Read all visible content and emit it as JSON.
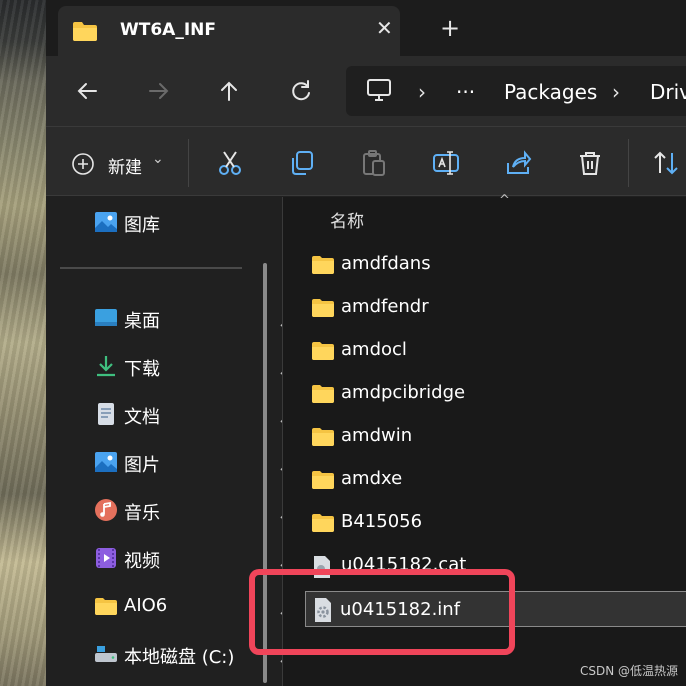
{
  "tab": {
    "title": "WT6A_INF",
    "close": "✕",
    "new_tab": "+"
  },
  "address": {
    "more": "···",
    "sep": "›",
    "crumbs": [
      "Packages",
      "Driv"
    ]
  },
  "command": {
    "new_label": "新建",
    "new_chevron": "⌄"
  },
  "nav": {
    "gallery": "图库",
    "items": [
      {
        "label": "桌面",
        "icon": "desktop-icon"
      },
      {
        "label": "下载",
        "icon": "download-icon"
      },
      {
        "label": "文档",
        "icon": "document-icon"
      },
      {
        "label": "图片",
        "icon": "pictures-icon"
      },
      {
        "label": "音乐",
        "icon": "music-icon"
      },
      {
        "label": "视频",
        "icon": "video-icon"
      },
      {
        "label": "AIO6",
        "icon": "folder-icon"
      },
      {
        "label": "本地磁盘 (C:)",
        "icon": "drive-icon"
      }
    ]
  },
  "list": {
    "column_name": "名称",
    "sort_caret": "^",
    "folders": [
      "amdfdans",
      "amdfendr",
      "amdocl",
      "amdpcibridge",
      "amdwin",
      "amdxe",
      "B415056"
    ],
    "partial_file": "u0415182.cat",
    "rename_value": "u0415182.inf"
  },
  "watermark": "CSDN @低温热源",
  "colors": {
    "accent": "#f0455a",
    "folder": "#f5c443",
    "background": "#191919"
  }
}
